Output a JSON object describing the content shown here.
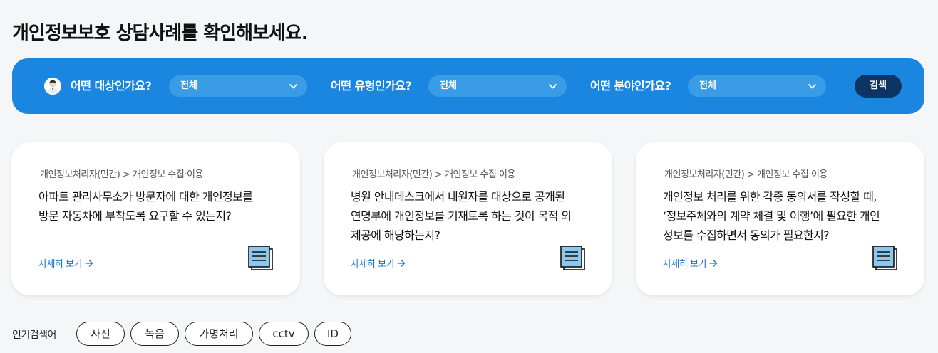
{
  "page_title": "개인정보보호 상담사례를 확인해보세요.",
  "filters": [
    {
      "label": "어떤 대상인가요?",
      "selected": "전체"
    },
    {
      "label": "어떤 유형인가요?",
      "selected": "전체"
    },
    {
      "label": "어떤 분야인가요?",
      "selected": "전체"
    }
  ],
  "search_button": "검색",
  "cards": [
    {
      "category": "개인정보처리자(민간) > 개인정보 수집·이용",
      "title": "아파트 관리사무소가 방문자에 대한 개인정보를 방문 자동차에 부착도록 요구할 수 있는지?",
      "link": "자세히 보기"
    },
    {
      "category": "개인정보처리자(민간) > 개인정보 수집·이용",
      "title": "병원 안내데스크에서 내원자를 대상으로 공개된 연명부에 개인정보를 기재토록 하는 것이 목적 외 제공에 해당하는지?",
      "link": "자세히 보기"
    },
    {
      "category": "개인정보처리자(민간) > 개인정보 수집·이용",
      "title": "개인정보 처리를 위한 각종 동의서를 작성할 때, ‘정보주체와의 계약 체결 및 이행’에 필요한 개인정보를 수집하면서 동의가 필요한지?",
      "link": "자세히 보기"
    }
  ],
  "popular": {
    "label": "인기검색어",
    "tags": [
      "사진",
      "녹음",
      "가명처리",
      "cctv",
      "ID"
    ]
  },
  "colors": {
    "search_bar": "#1a86e0",
    "select_bg": "#3a9be6",
    "search_button": "#0d3563",
    "link": "#1a72c9",
    "doc_icon_fill": "#8cc8ee"
  }
}
